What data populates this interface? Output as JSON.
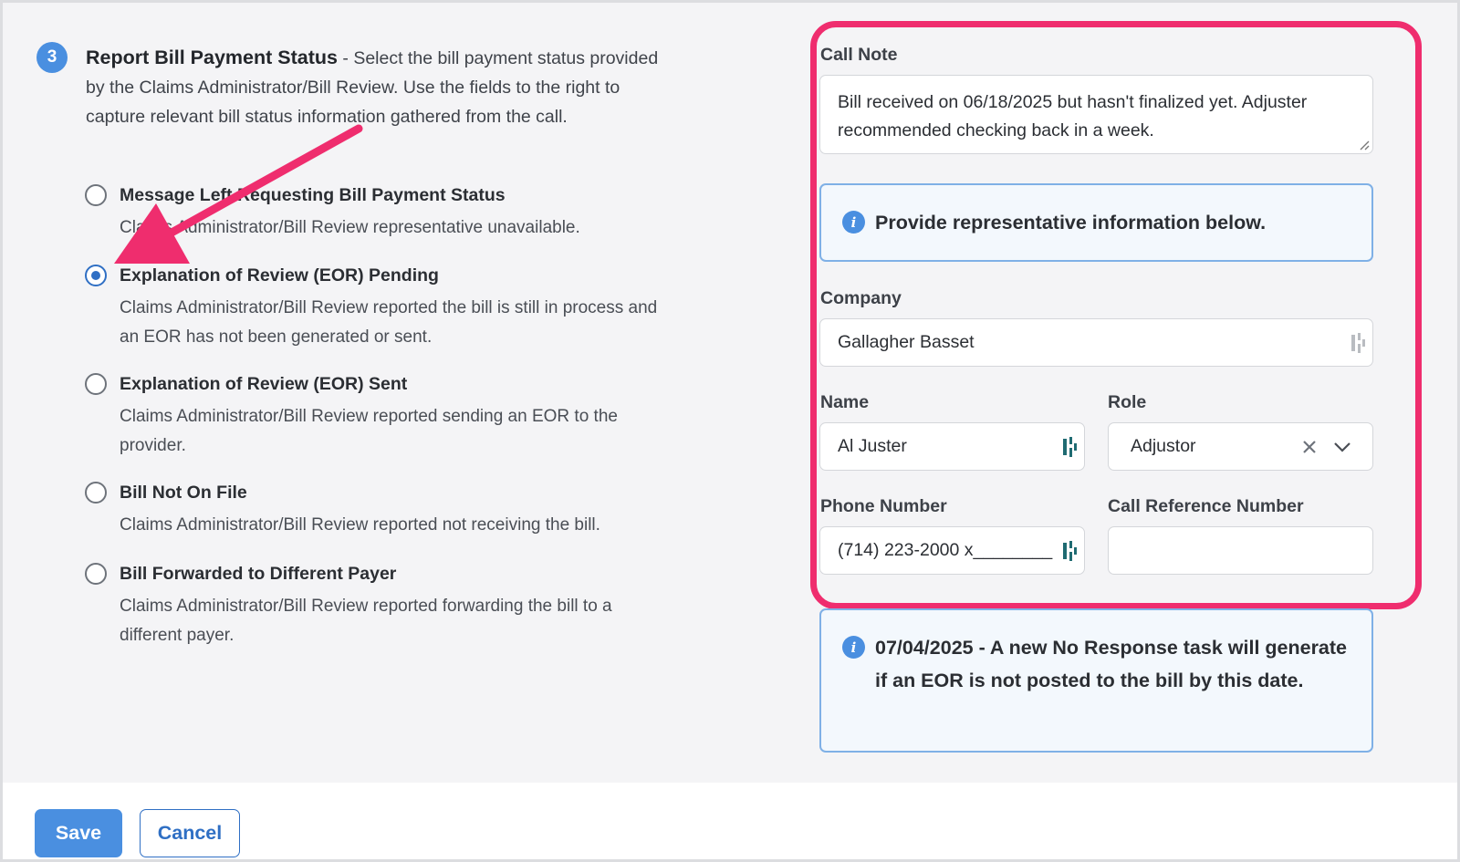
{
  "section": {
    "step": "3",
    "title": "Report Bill Payment Status",
    "description": " - Select the bill payment status provided by the Claims Administrator/Bill Review. Use the fields to the right to capture relevant bill status information gathered from the call."
  },
  "options": [
    {
      "label": "Message Left Requesting Bill Payment Status",
      "description": "Claims Administrator/Bill Review representative unavailable.",
      "selected": false
    },
    {
      "label": "Explanation of Review (EOR) Pending",
      "description": "Claims Administrator/Bill Review reported the bill is still in process and an EOR has not been generated or sent.",
      "selected": true
    },
    {
      "label": "Explanation of Review (EOR) Sent",
      "description": "Claims Administrator/Bill Review reported sending an EOR to the provider.",
      "selected": false
    },
    {
      "label": "Bill Not On File",
      "description": "Claims Administrator/Bill Review reported not receiving the bill.",
      "selected": false
    },
    {
      "label": "Bill Forwarded to Different Payer",
      "description": "Claims Administrator/Bill Review reported forwarding the bill to a different payer.",
      "selected": false
    }
  ],
  "form": {
    "call_note_label": "Call Note",
    "call_note_value": "Bill received on 06/18/2025 but hasn't finalized yet. Adjuster recommended checking back in a week.",
    "rep_info_text": "Provide representative information below.",
    "company_label": "Company",
    "company_value": "Gallagher Basset",
    "name_label": "Name",
    "name_value": "Al Juster",
    "role_label": "Role",
    "role_value": "Adjustor",
    "phone_label": "Phone Number",
    "phone_value": "(714) 223-2000 x________",
    "call_ref_label": "Call Reference Number",
    "call_ref_value": ""
  },
  "notice": {
    "text": "07/04/2025 - A new No Response task will generate if an EOR is not posted to the bill by this date."
  },
  "buttons": {
    "save": "Save",
    "cancel": "Cancel"
  },
  "colors": {
    "accent": "#4a8fe0",
    "annotation": "#ef2d6e",
    "field_icon": "#1f6b72"
  }
}
